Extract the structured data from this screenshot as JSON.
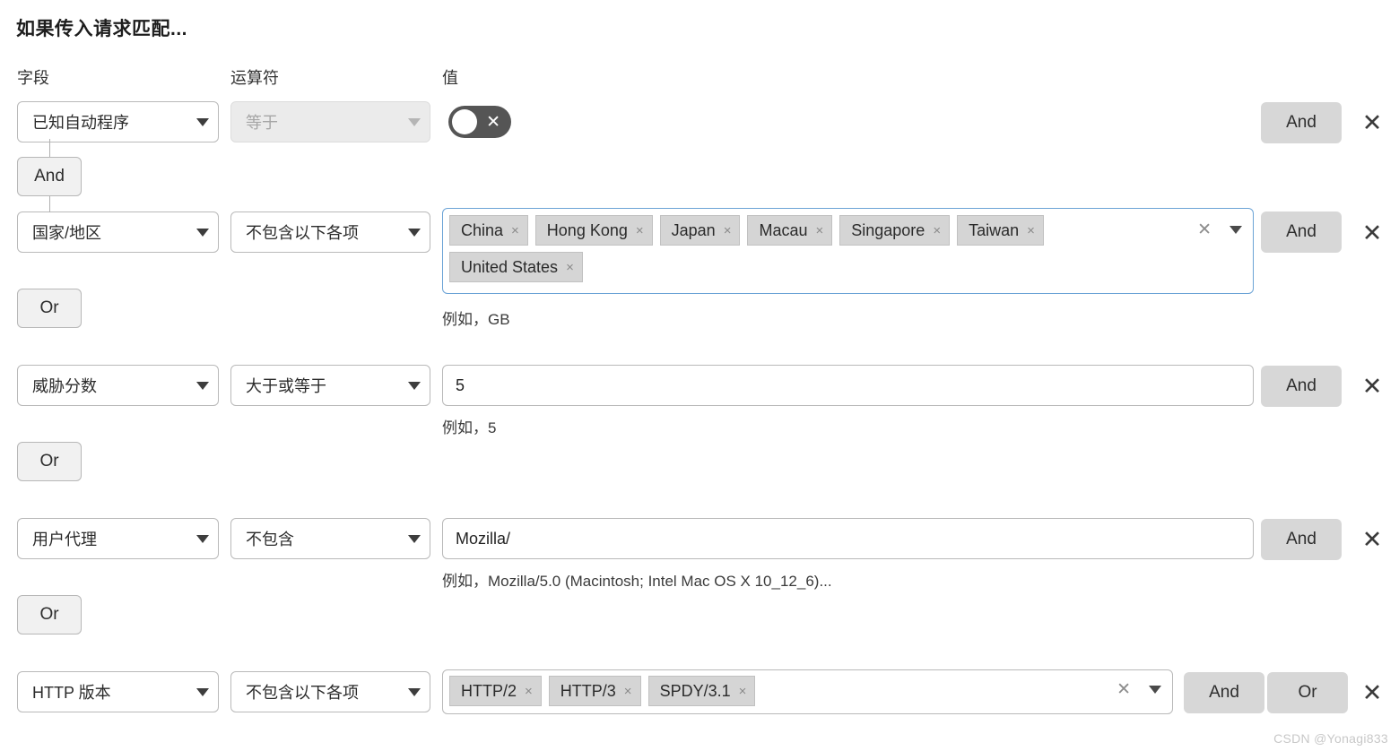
{
  "heading": "如果传入请求匹配...",
  "columns": {
    "field": "字段",
    "operator": "运算符",
    "value": "值"
  },
  "labels": {
    "and": "And",
    "or": "Or",
    "close_icon": "✕",
    "tag_remove_icon": "×",
    "clear_icon": "✕",
    "toggle_off_icon": "✕"
  },
  "rows": [
    {
      "field": "已知自动程序",
      "operator": "等于",
      "operator_disabled": true,
      "value_type": "toggle",
      "toggle_on": false,
      "hint": "",
      "and_label": "And",
      "close_label": "✕"
    },
    {
      "field": "国家/地区",
      "operator": "不包含以下各项",
      "value_type": "tags",
      "tags": [
        "China",
        "Hong Kong",
        "Japan",
        "Macau",
        "Singapore",
        "Taiwan",
        "United States"
      ],
      "hint": "例如，GB",
      "and_label": "And",
      "close_label": "✕"
    },
    {
      "field": "威胁分数",
      "operator": "大于或等于",
      "value_type": "text",
      "value": "5",
      "hint": "例如，5",
      "and_label": "And",
      "close_label": "✕"
    },
    {
      "field": "用户代理",
      "operator": "不包含",
      "value_type": "text",
      "value": "Mozilla/",
      "hint": "例如，Mozilla/5.0 (Macintosh; Intel Mac OS X 10_12_6)...",
      "and_label": "And",
      "close_label": "✕"
    },
    {
      "field": "HTTP 版本",
      "operator": "不包含以下各项",
      "value_type": "tags",
      "tags": [
        "HTTP/2",
        "HTTP/3",
        "SPDY/3.1"
      ],
      "hint": "",
      "and_label": "And",
      "or_label": "Or",
      "close_label": "✕"
    }
  ],
  "connectors": [
    {
      "label": "And",
      "has_line": true
    },
    {
      "label": "Or",
      "has_line": false
    },
    {
      "label": "Or",
      "has_line": false
    },
    {
      "label": "Or",
      "has_line": false
    }
  ],
  "watermark": "CSDN @Yonagi833",
  "colors": {
    "focus_border": "#6ba3d6",
    "tag_bg": "#d5d5d5",
    "button_bg": "#d7d7d7",
    "connector_bg": "#f1f1f1",
    "disabled_bg": "#ebebeb",
    "toggle_bg": "#555555"
  }
}
